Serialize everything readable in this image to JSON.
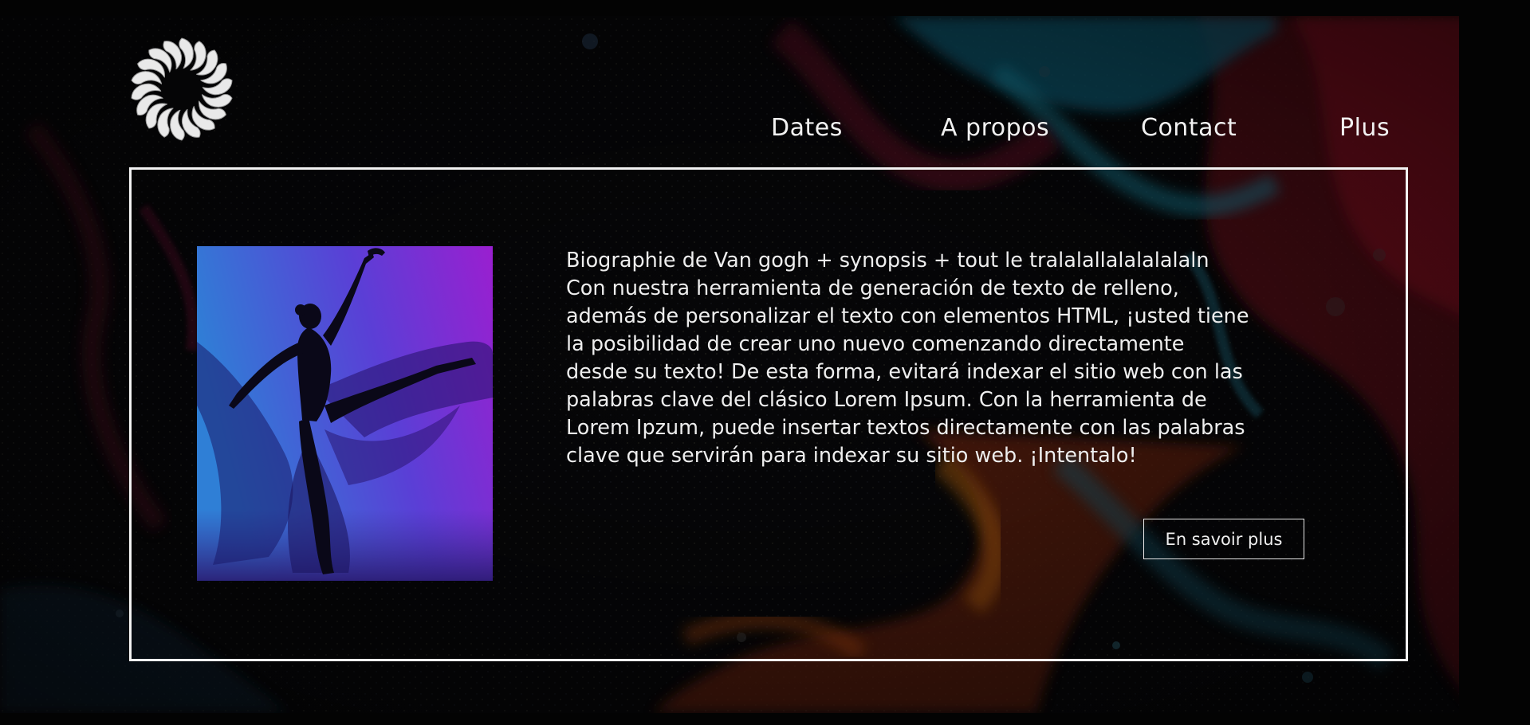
{
  "header": {
    "logo_icon": "spiral-dancers-logo-icon",
    "nav": [
      {
        "label": "Dates"
      },
      {
        "label": "A propos"
      },
      {
        "label": "Contact"
      },
      {
        "label": "Plus"
      }
    ]
  },
  "main": {
    "photo_icon": "dancer-silhouette-image",
    "bio_lines": [
      "Biographie de Van gogh + synopsis + tout le tralalallalalalalaln",
      "Con nuestra herramienta de generación de texto de relleno,",
      "además de personalizar el texto con elementos HTML, ¡usted tiene",
      "la posibilidad de crear uno nuevo comenzando directamente",
      "desde su texto! De esta forma, evitará indexar el sitio web con las",
      "palabras clave del clásico Lorem Ipsum. Con la herramienta de",
      "Lorem Ipzum, puede insertar textos directamente con las palabras",
      "clave que servirán para indexar su sitio web. ¡Intentalo!"
    ],
    "cta_label": "En savoir plus"
  },
  "colors": {
    "background": "#050506",
    "frame": "#f2f2f2",
    "text": "#eeeeee",
    "photo_gradient_start": "#2f7fd6",
    "photo_gradient_end": "#9a1fd0"
  }
}
